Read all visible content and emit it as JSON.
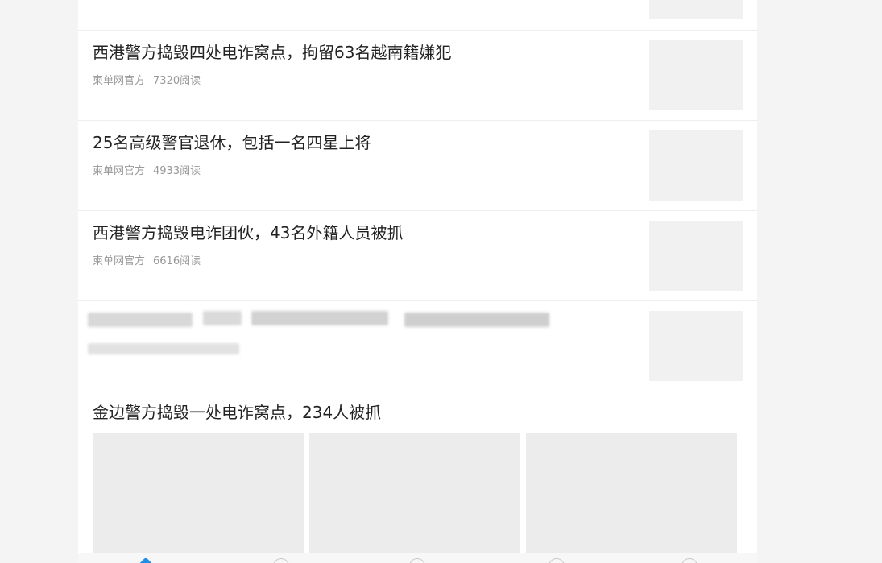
{
  "articles": [
    {
      "title": "西港警方捣毁四处电诈窝点，拘留63名越南籍嫌犯",
      "source": "柬单网官方",
      "views": "7320阅读"
    },
    {
      "title": "25名高级警官退休，包括一名四星上将",
      "source": "柬单网官方",
      "views": "4933阅读"
    },
    {
      "title": "西港警方捣毁电诈团伙，43名外籍人员被抓",
      "source": "柬单网官方",
      "views": "6616阅读"
    }
  ],
  "gallery_article": {
    "title": "金边警方捣毁一处电诈窝点，234人被抓"
  },
  "colors": {
    "accent": "#1f8ee8",
    "title_text": "#222222",
    "meta_text": "#999999",
    "placeholder": "#f1f1f1"
  },
  "tab_icons": [
    "home-icon",
    "circle-icon",
    "circle-icon",
    "message-icon",
    "profile-icon"
  ]
}
